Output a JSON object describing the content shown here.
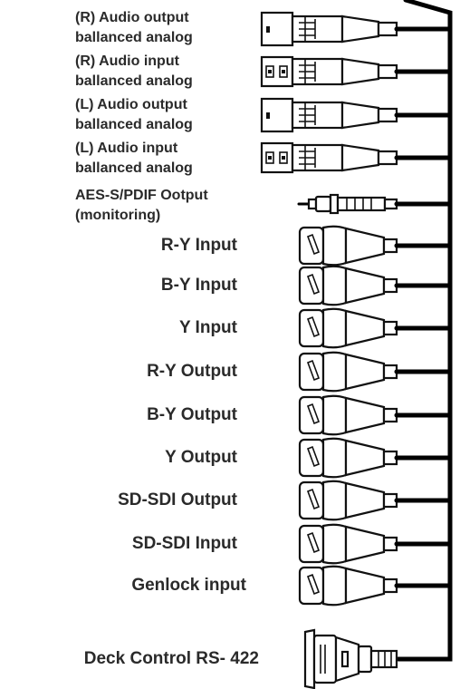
{
  "connectors": [
    {
      "id": "r-audio-out",
      "kind": "xlr-male",
      "lines": [
        "(R) Audio output",
        "ballanced analog"
      ]
    },
    {
      "id": "r-audio-in",
      "kind": "xlr-female",
      "lines": [
        "(R) Audio input",
        "ballanced analog"
      ]
    },
    {
      "id": "l-audio-out",
      "kind": "xlr-male",
      "lines": [
        "(L) Audio output",
        "ballanced analog"
      ]
    },
    {
      "id": "l-audio-in",
      "kind": "xlr-female",
      "lines": [
        "(L) Audio input",
        "ballanced analog"
      ]
    },
    {
      "id": "aes-out",
      "kind": "rca",
      "lines": [
        "AES-S/PDIF Ootput",
        "(monitoring)"
      ]
    },
    {
      "id": "ry-in",
      "kind": "bnc",
      "label": "R-Y Input"
    },
    {
      "id": "by-in",
      "kind": "bnc",
      "label": "B-Y Input"
    },
    {
      "id": "y-in",
      "kind": "bnc",
      "label": "Y Input"
    },
    {
      "id": "ry-out",
      "kind": "bnc",
      "label": "R-Y Output"
    },
    {
      "id": "by-out",
      "kind": "bnc",
      "label": "B-Y Output"
    },
    {
      "id": "y-out",
      "kind": "bnc",
      "label": "Y Output"
    },
    {
      "id": "sdi-out",
      "kind": "bnc",
      "label": "SD-SDI Output"
    },
    {
      "id": "sdi-in",
      "kind": "bnc",
      "label": "SD-SDI Input"
    },
    {
      "id": "genlock-in",
      "kind": "bnc",
      "label": "Genlock input"
    },
    {
      "id": "deck-rs422",
      "kind": "dsub",
      "label": "Deck Control RS- 422"
    }
  ]
}
